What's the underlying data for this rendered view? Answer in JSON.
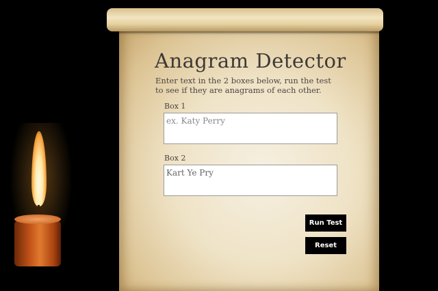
{
  "app": {
    "title": "Anagram Detector",
    "instructions": "Enter text in the 2 boxes below, run the test to see if they are anagrams of each other."
  },
  "box1": {
    "label": "Box 1",
    "placeholder": "ex. Katy Perry",
    "value": ""
  },
  "box2": {
    "label": "Box 2",
    "placeholder": "",
    "value": "Kart Ye Pry"
  },
  "buttons": {
    "run_label": "Run Test",
    "reset_label": "Reset"
  },
  "colors": {
    "background": "#000000",
    "button_bg": "#000000",
    "button_text": "#ffffff",
    "title_text": "#3e3a35"
  }
}
